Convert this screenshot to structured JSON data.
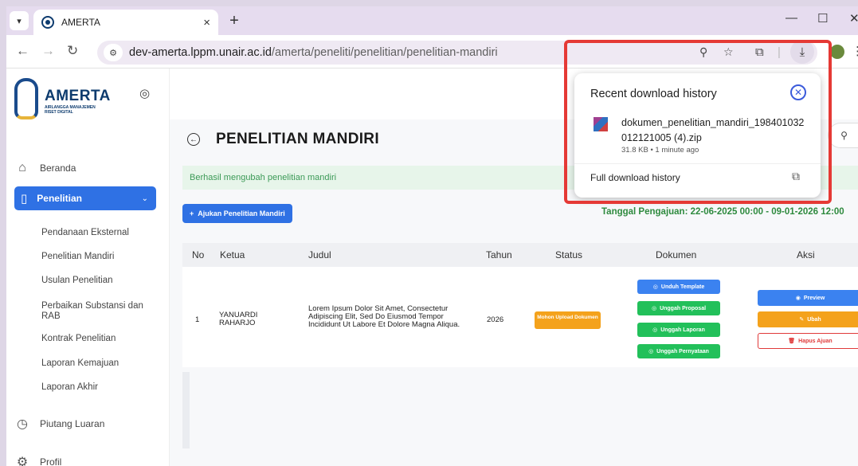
{
  "browser": {
    "tab_title": "AMERTA",
    "url_host": "dev-amerta.lppm.unair.ac.id",
    "url_path": "/amerta/peneliti/penelitian/penelitian-mandiri"
  },
  "logo": {
    "brand": "AMERTA",
    "subtitle": "AIRLANGGA MANAJEMEN RISET DIGITAL"
  },
  "sidebar": {
    "items": [
      {
        "label": "Beranda",
        "icon": "home-icon"
      },
      {
        "label": "Penelitian",
        "icon": "book-icon",
        "active": true
      },
      {
        "label": "Piutang Luaran",
        "icon": "clock-icon"
      },
      {
        "label": "Profil",
        "icon": "gear-icon"
      }
    ],
    "subitems": [
      "Pendanaan Eksternal",
      "Penelitian Mandiri",
      "Usulan Penelitian",
      "Perbaikan Substansi dan RAB",
      "Kontrak Penelitian",
      "Laporan Kemajuan",
      "Laporan Akhir"
    ]
  },
  "page": {
    "title": "PENELITIAN MANDIRI",
    "alert": "Berhasil mengubah penelitian mandiri",
    "submit_button": "Ajukan Penelitian Mandiri",
    "submission_period": "Tanggal Pengajuan: 22-06-2025 00:00 - 09-01-2026 12:00"
  },
  "table": {
    "headers": [
      "No",
      "Ketua",
      "Judul",
      "Tahun",
      "Status",
      "Dokumen",
      "Aksi"
    ],
    "rows": [
      {
        "no": "1",
        "ketua": "YANUARDI RAHARJO",
        "judul": "Lorem Ipsum Dolor Sit Amet, Consectetur Adipiscing Elit, Sed Do Eiusmod Tempor Incididunt Ut Labore Et Dolore Magna Aliqua.",
        "tahun": "2026",
        "status": "Mohon Upload Dokumen",
        "dokumen": [
          "Unduh Template",
          "Unggah Proposal",
          "Unggah Laporan",
          "Unggah Pernyataan"
        ],
        "aksi": [
          "Preview",
          "Ubah",
          "Hapus Ajuan"
        ]
      }
    ]
  },
  "download_popup": {
    "title": "Recent download history",
    "file_name": "dokumen_penelitian_mandiri_198401032012121005 (4).zip",
    "file_meta": "31.8 KB • 1 minute ago",
    "full_history": "Full download history"
  },
  "colors": {
    "primary": "#2f71e4",
    "success": "#22c05a",
    "warning": "#f4a21c",
    "danger": "#e03a3a",
    "highlight": "#e53935"
  }
}
